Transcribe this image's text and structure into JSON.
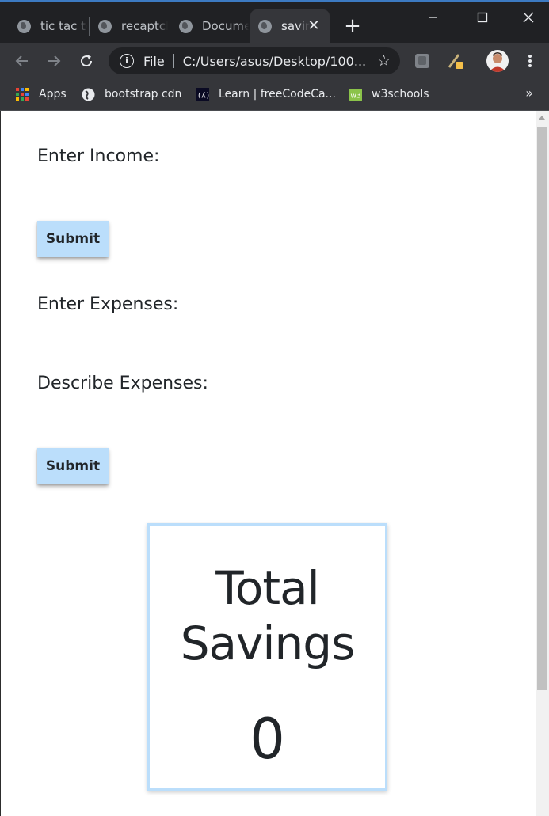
{
  "browser": {
    "tabs": [
      {
        "title": "tic tac toe",
        "active": false
      },
      {
        "title": "recaptcha",
        "active": false
      },
      {
        "title": "Document",
        "active": false
      },
      {
        "title": "savings",
        "active": true
      }
    ],
    "address_bar": {
      "scheme_label": "File",
      "url": "C:/Users/asus/Desktop/100..."
    },
    "bookmarks": [
      {
        "label": "Apps",
        "icon": "apps-grid-icon"
      },
      {
        "label": "bootstrap cdn",
        "icon": "globe-icon"
      },
      {
        "label": "Learn | freeCodeCa...",
        "icon": "freecodecamp-icon"
      },
      {
        "label": "w3schools",
        "icon": "w3schools-icon"
      }
    ],
    "bookmarks_overflow": "»",
    "new_tab_symbol": "+",
    "tab_close_symbol": "✕"
  },
  "page": {
    "income": {
      "label": "Enter Income:",
      "value": "",
      "placeholder": ""
    },
    "income_submit_label": "Submit",
    "expenses": {
      "label": "Enter Expenses:",
      "value": "",
      "placeholder": ""
    },
    "description": {
      "label": "Describe Expenses:",
      "value": "",
      "placeholder": ""
    },
    "expenses_submit_label": "Submit",
    "savings_card": {
      "title_line1": "Total",
      "title_line2": "Savings",
      "value": "0"
    }
  },
  "colors": {
    "chrome_dark": "#202124",
    "toolbar": "#35363a",
    "button_bg": "#bbdefb",
    "card_border": "#bbdefb",
    "text": "#212529"
  }
}
